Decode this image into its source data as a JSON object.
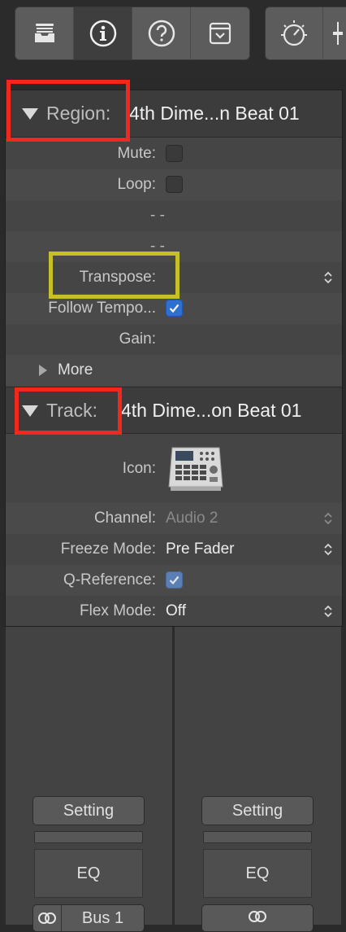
{
  "toolbar": {
    "left_buttons": [
      {
        "icon": "library-icon",
        "active": false
      },
      {
        "icon": "info-icon",
        "active": true
      },
      {
        "icon": "help-icon",
        "active": false
      },
      {
        "icon": "toolbar-icon",
        "active": false
      }
    ],
    "right_buttons": [
      {
        "icon": "smart-controls-icon"
      },
      {
        "icon": "mixer-icon"
      }
    ]
  },
  "region": {
    "label": "Region:",
    "name": "4th Dime...n Beat 01",
    "mute_label": "Mute:",
    "loop_label": "Loop:",
    "dash_1": "- -",
    "dash_2": "- -",
    "transpose_label": "Transpose:",
    "follow_tempo_label": "Follow Tempo...",
    "gain_label": "Gain:",
    "more_label": "More"
  },
  "track": {
    "label": "Track:",
    "name": "4th Dime...on Beat 01",
    "icon_label": "Icon:",
    "channel_label": "Channel:",
    "channel_value": "Audio 2",
    "freeze_label": "Freeze Mode:",
    "freeze_value": "Pre Fader",
    "qref_label": "Q-Reference:",
    "flex_label": "Flex Mode:",
    "flex_value": "Off"
  },
  "mixer": {
    "strip1": {
      "setting": "Setting",
      "eq": "EQ",
      "bus": "Bus 1"
    },
    "strip2": {
      "setting": "Setting",
      "eq": "EQ"
    }
  },
  "colors": {
    "highlight_red": "#f2271d",
    "highlight_olive": "#c6c026",
    "checkbox_on": "#2f6fd0"
  }
}
